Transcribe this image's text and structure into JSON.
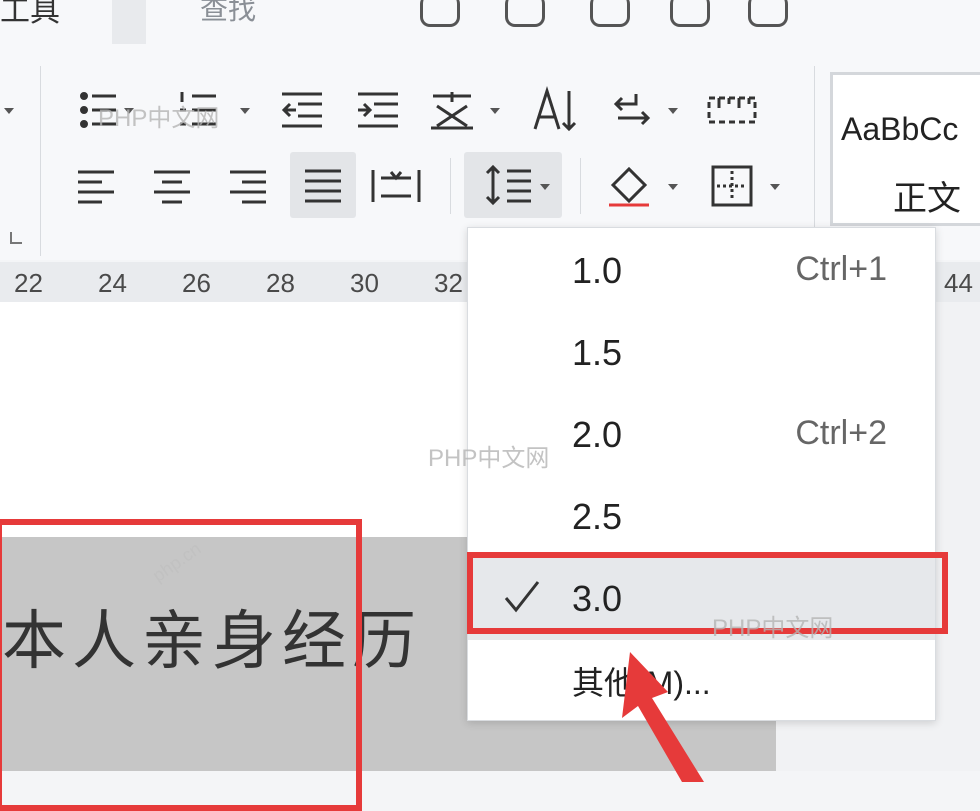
{
  "toolbar_top": {
    "tools_label_partial": "工具",
    "search_label_partial": "查找"
  },
  "ribbon": {
    "style_card": {
      "sample": "AaBbCc",
      "name": "正文"
    }
  },
  "ruler": {
    "ticks": [
      "22",
      "24",
      "26",
      "28",
      "30",
      "32",
      "44"
    ]
  },
  "document": {
    "text": "本人亲身经历"
  },
  "line_spacing_menu": {
    "items": [
      {
        "value": "1.0",
        "shortcut": "Ctrl+1",
        "selected": false
      },
      {
        "value": "1.5",
        "shortcut": "",
        "selected": false
      },
      {
        "value": "2.0",
        "shortcut": "Ctrl+2",
        "selected": false
      },
      {
        "value": "2.5",
        "shortcut": "",
        "selected": false
      },
      {
        "value": "3.0",
        "shortcut": "",
        "selected": true
      }
    ],
    "other": "其他(M)..."
  },
  "watermarks": [
    "PHP中文网",
    "PHP中文网",
    "PHP中文网",
    "php.cn"
  ],
  "colors": {
    "highlight_red": "#e63a3a",
    "selection_gray": "#c6c6c6"
  },
  "icons": [
    "bullet-list-icon",
    "numbered-list-icon",
    "decrease-indent-icon",
    "increase-indent-icon",
    "chinese-layout-icon",
    "text-direction-icon",
    "sort-icon",
    "ruler-toggle-icon",
    "align-left-icon",
    "align-center-icon",
    "align-right-icon",
    "justify-icon",
    "distributed-icon",
    "line-spacing-icon",
    "shading-icon",
    "borders-icon",
    "checkmark-icon",
    "arrow-icon"
  ]
}
